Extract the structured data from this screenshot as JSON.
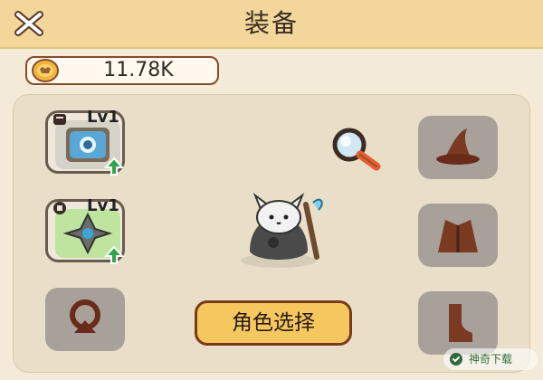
{
  "header": {
    "title": "装备"
  },
  "currency": {
    "amount": "11.78K"
  },
  "left_slots": [
    {
      "level": "Lv1",
      "type": "book"
    },
    {
      "level": "Lv1",
      "type": "shuriken"
    }
  ],
  "right_slots": [
    {
      "type": "wizard-hat"
    },
    {
      "type": "robe"
    },
    {
      "type": "boots"
    }
  ],
  "bottom_left_slot": {
    "type": "ring"
  },
  "actions": {
    "role_select_label": "角色选择"
  },
  "watermark": {
    "text": "神奇下载"
  },
  "colors": {
    "top_bar": "#f3d79a",
    "panel": "#e9dfc8",
    "button": "#f4c85e",
    "button_border": "#7a3a1a",
    "upgrade_arrow": "#2fa548",
    "locked_slot": "#a8a19a"
  }
}
